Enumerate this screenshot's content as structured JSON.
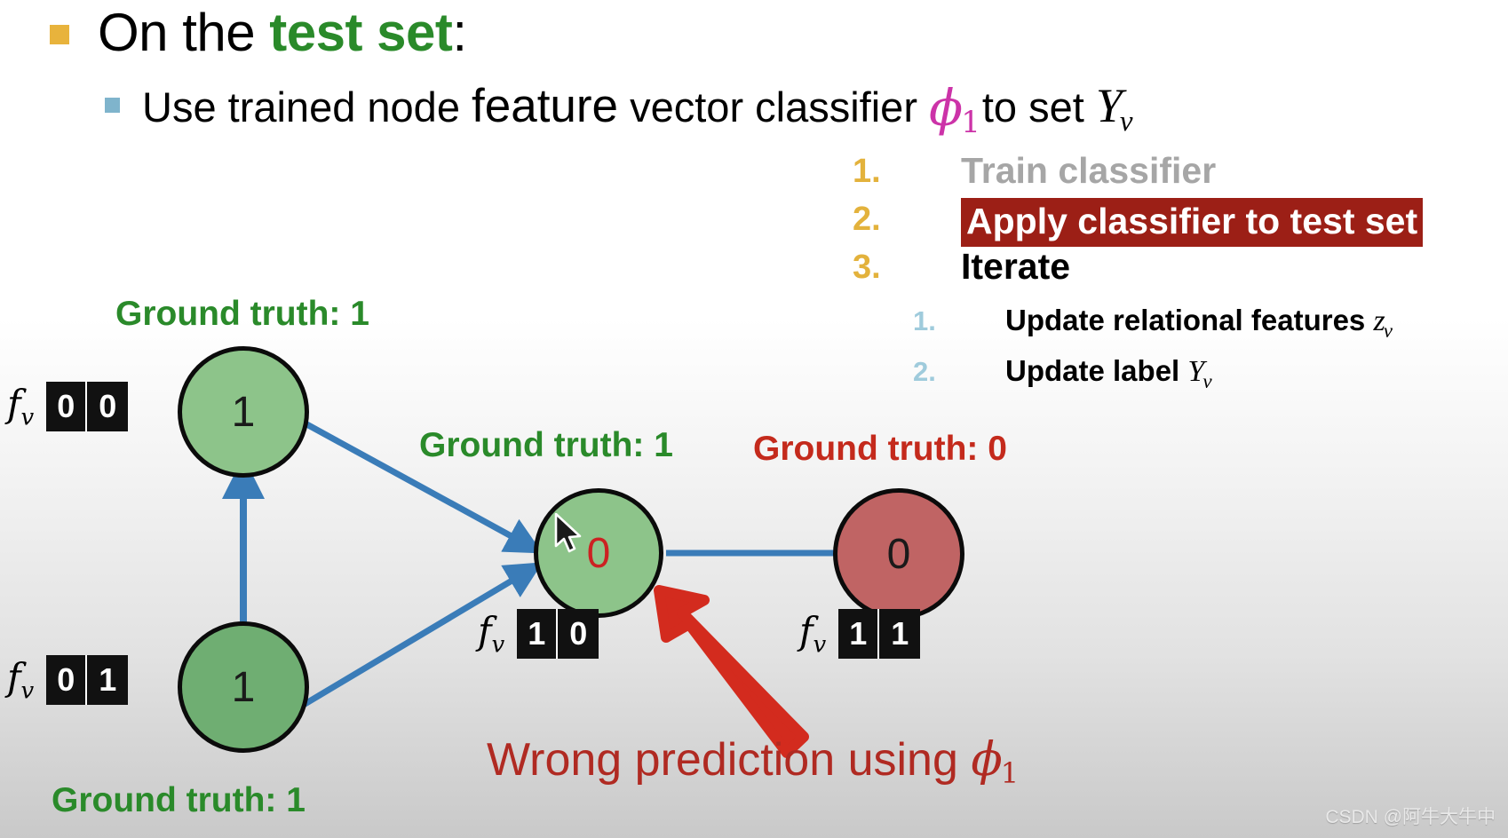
{
  "slide": {
    "heading": {
      "prefix": "On the ",
      "emphasis": "test set",
      "suffix": ":"
    },
    "subheading": {
      "part1": "Use trained node ",
      "feature_word": "feature",
      "part2": " vector classifier ",
      "phi_symbol": "ϕ",
      "phi_subscript": "1",
      "part3": "to set ",
      "label_symbol": "Y",
      "label_subscript": "v"
    }
  },
  "steps": {
    "items": [
      {
        "num": "1.",
        "text": "Train classifier",
        "state": "done"
      },
      {
        "num": "2.",
        "text": "Apply classifier to test set",
        "state": "active"
      },
      {
        "num": "3.",
        "text": "Iterate",
        "state": "pending"
      }
    ],
    "substeps": [
      {
        "num": "1.",
        "text": "Update relational features ",
        "math_symbol": "z",
        "math_subscript": "v"
      },
      {
        "num": "2.",
        "text": "Update label ",
        "math_symbol": "Y",
        "math_subscript": "v"
      }
    ]
  },
  "graph": {
    "nodes": [
      {
        "id": "top-left",
        "label": "1",
        "ground_truth": "Ground truth: 1",
        "gt_color": "#2a8a2a",
        "fill": "#8dc48a",
        "feature_label": "f",
        "feature_subscript": "v",
        "feature_vector": [
          "0",
          "0"
        ],
        "prediction_wrong": false
      },
      {
        "id": "bottom-left",
        "label": "1",
        "ground_truth": "Ground truth: 1",
        "gt_color": "#2a8a2a",
        "fill": "#6fae72",
        "feature_label": "f",
        "feature_subscript": "v",
        "feature_vector": [
          "0",
          "1"
        ],
        "prediction_wrong": false
      },
      {
        "id": "center",
        "label": "0",
        "ground_truth": "Ground truth: 1",
        "gt_color": "#2a8a2a",
        "fill": "#8dc48a",
        "feature_label": "f",
        "feature_subscript": "v",
        "feature_vector": [
          "1",
          "0"
        ],
        "prediction_wrong": true
      },
      {
        "id": "right",
        "label": "0",
        "ground_truth": "Ground truth: 0",
        "gt_color": "#c42a1c",
        "fill": "#c06464",
        "feature_label": "f",
        "feature_subscript": "v",
        "feature_vector": [
          "1",
          "1"
        ],
        "prediction_wrong": false
      }
    ],
    "edge_color": "#3a7cb8"
  },
  "caption": {
    "text": "Wrong prediction using ",
    "phi_symbol": "ϕ",
    "phi_subscript": "1"
  },
  "watermark": {
    "text": "CSDN @阿牛大牛中"
  },
  "colors": {
    "bullet_level1": "#e8b33c",
    "bullet_level2": "#7fb4cc",
    "highlight_bg": "#9c1f16",
    "green_accent": "#2a8a2a",
    "red_accent": "#b02a22",
    "phi_magenta": "#cc33a8",
    "edge_blue": "#3a7cb8",
    "arrow_red": "#d32b1e"
  }
}
